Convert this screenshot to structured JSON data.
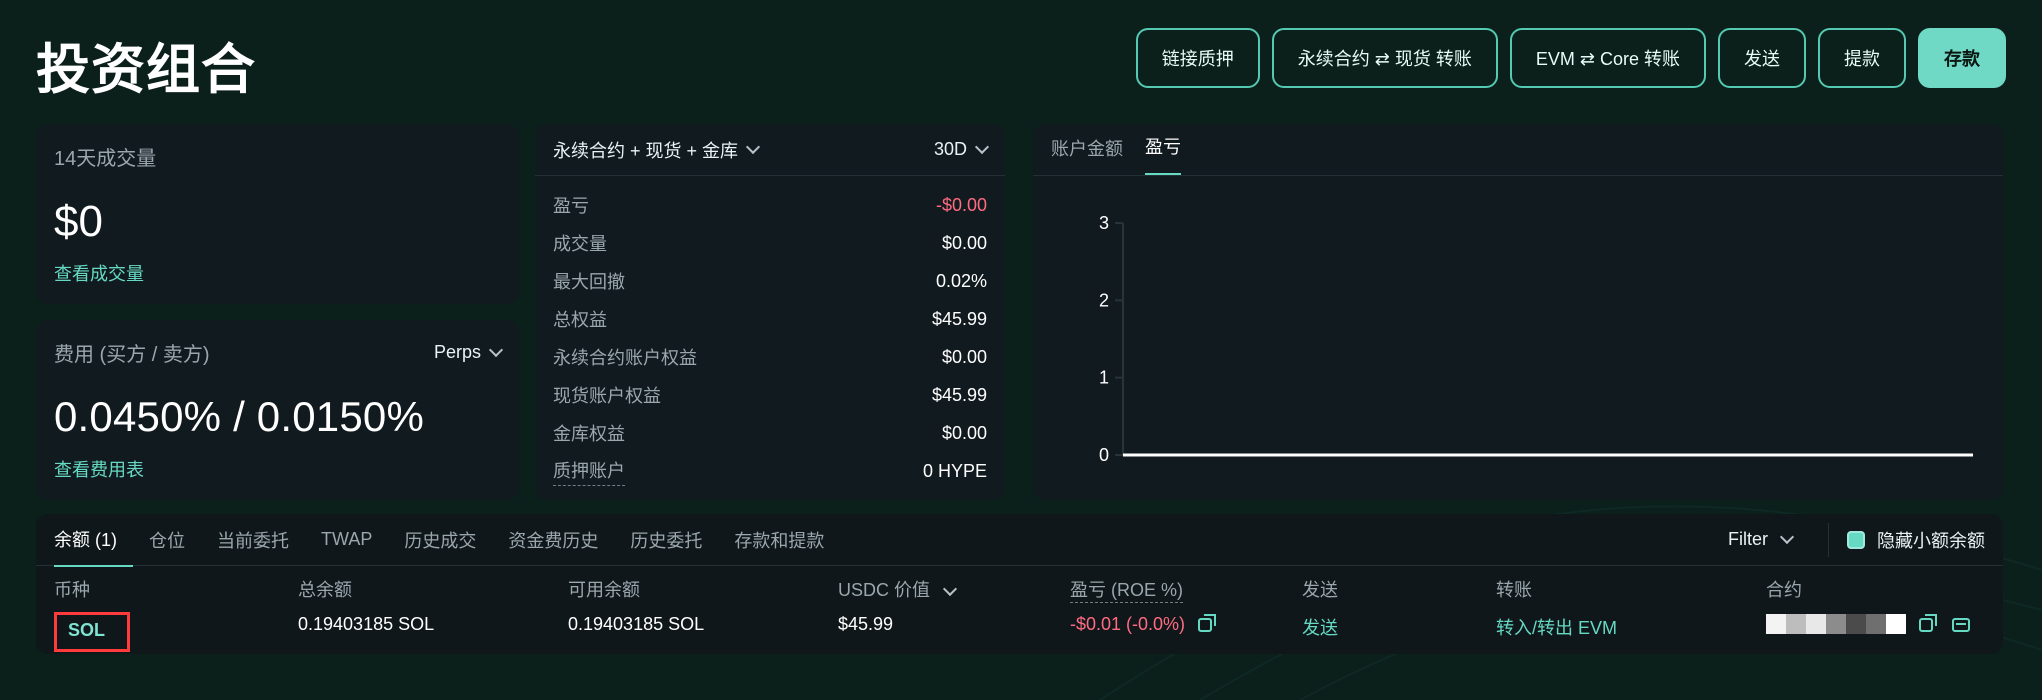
{
  "page": {
    "title": "投资组合"
  },
  "header": {
    "buttons": [
      {
        "label": "链接质押"
      },
      {
        "label": "永续合约 ⇄ 现货 转账"
      },
      {
        "label": "EVM ⇄ Core 转账"
      },
      {
        "label": "发送"
      },
      {
        "label": "提款"
      },
      {
        "label": "存款"
      }
    ]
  },
  "cards": {
    "volume_14d": {
      "label": "14天成交量",
      "value": "$0",
      "link": "查看成交量"
    },
    "fees": {
      "label": "费用 (买方 / 卖方)",
      "dropdown_value": "Perps",
      "value": "0.0450% / 0.0150%",
      "link": "查看费用表"
    },
    "metrics": {
      "scope_dropdown": "永续合约 + 现货 + 金库",
      "range_dropdown": "30D",
      "rows": [
        {
          "k": "盈亏",
          "v": "-$0.00"
        },
        {
          "k": "成交量",
          "v": "$0.00"
        },
        {
          "k": "最大回撤",
          "v": "0.02%"
        },
        {
          "k": "总权益",
          "v": "$45.99"
        },
        {
          "k": "永续合约账户权益",
          "v": "$0.00"
        },
        {
          "k": "现货账户权益",
          "v": "$45.99"
        },
        {
          "k": "金库权益",
          "v": "$0.00"
        },
        {
          "k": "质押账户",
          "v": "0 HYPE"
        }
      ]
    },
    "chart": {
      "tabs": [
        {
          "label": "账户金额"
        },
        {
          "label": "盈亏"
        }
      ],
      "active_tab": "盈亏"
    }
  },
  "chart_data": {
    "type": "line",
    "title": "",
    "xlabel": "",
    "ylabel": "",
    "ylim": [
      0,
      3
    ],
    "yticks": [
      0,
      1,
      2,
      3
    ],
    "series": [
      {
        "values": [
          0,
          0
        ]
      }
    ],
    "x": [
      "",
      ""
    ],
    "grid": false,
    "legend": "none"
  },
  "bottom": {
    "tabs": [
      {
        "label": "余额 (1)"
      },
      {
        "label": "仓位"
      },
      {
        "label": "当前委托"
      },
      {
        "label": "TWAP"
      },
      {
        "label": "历史成交"
      },
      {
        "label": "资金费历史"
      },
      {
        "label": "历史委托"
      },
      {
        "label": "存款和提款"
      }
    ],
    "active_tab": "余额 (1)",
    "filter_label": "Filter",
    "hide_small_balances_label": "隐藏小额余额",
    "table": {
      "headers": {
        "coin": "币种",
        "total": "总余额",
        "available": "可用余额",
        "usdc_value": "USDC 价值",
        "pnl": "盈亏 (ROE %)",
        "send": "发送",
        "transfer": "转账",
        "contract": "合约"
      },
      "rows": [
        {
          "coin": "SOL",
          "total": "0.19403185 SOL",
          "available": "0.19403185 SOL",
          "usdc_value": "$45.99",
          "pnl": "-$0.01 (-0.0%)",
          "send": "发送",
          "transfer": "转入/转出 EVM"
        }
      ]
    }
  },
  "colors": {
    "background": "#0b1f1b",
    "panel": "#111a1f",
    "accent": "#66d9c2",
    "negative": "#ff6b81",
    "highlight": "#ff3b3b"
  }
}
